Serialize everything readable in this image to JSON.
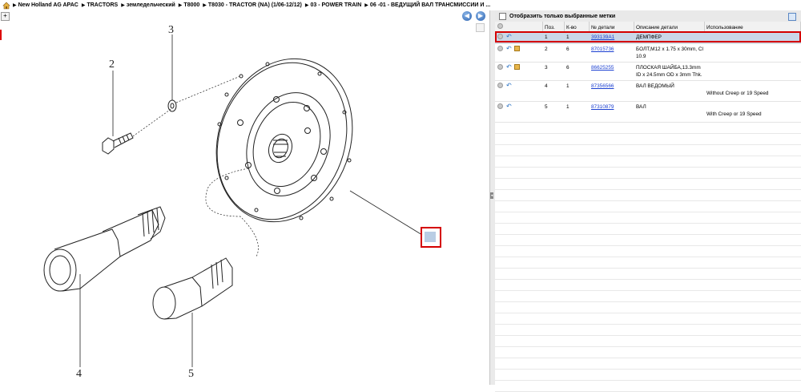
{
  "breadcrumb": {
    "items": [
      "New Holland AG APAC",
      "TRACTORS",
      "земледельческий",
      "T8000",
      "T8030 - TRACTOR (NA) (1/06-12/12)",
      "03 - POWER TRAIN",
      "06 -01 - ВЕДУЩИЙ ВАЛ ТРАНСМИССИИ И ..."
    ]
  },
  "diagram": {
    "callouts": [
      "1",
      "2",
      "3",
      "4",
      "5"
    ]
  },
  "filter": {
    "label": "Отобразить только выбранные метки"
  },
  "table": {
    "headers": [
      "Поз.",
      "К-во",
      "№ детали",
      "Описание детали",
      "Использование"
    ],
    "rows": [
      {
        "pos": "1",
        "qty": "1",
        "part": "393139A1",
        "desc": "ДЕМПФЕР",
        "use": ""
      },
      {
        "pos": "2",
        "qty": "6",
        "part": "87015736",
        "desc": "БОЛТ,M12 x 1.75 x 30mm, Cl 10.9",
        "use": ""
      },
      {
        "pos": "3",
        "qty": "6",
        "part": "86625255",
        "desc": "ПЛОСКАЯ ШАЙБА,13.3mm ID x 24.5mm OD x 3mm Thk.",
        "use": ""
      },
      {
        "pos": "4",
        "qty": "1",
        "part": "87356566",
        "desc": "ВАЛ ВЕДОМЫЙ",
        "use": "Without Creep or 19 Speed"
      },
      {
        "pos": "5",
        "qty": "1",
        "part": "87310879",
        "desc": "ВАЛ",
        "use": "With Creep or 19 Speed"
      }
    ]
  },
  "colors": {
    "selection": "#cad7e8",
    "highlight_red": "#d40000",
    "link": "#1a3fd1"
  }
}
